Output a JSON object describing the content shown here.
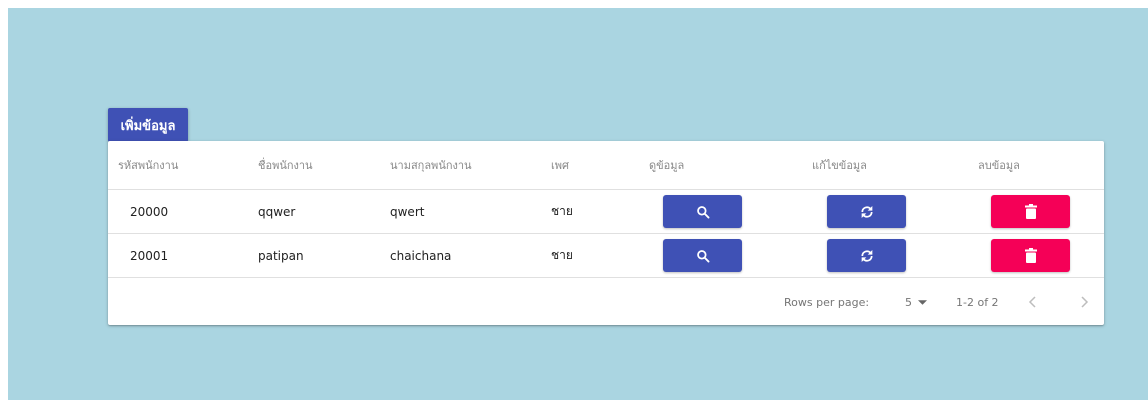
{
  "toolbar": {
    "add_label": "เพิ่มข้อมูล"
  },
  "table": {
    "headers": [
      "รหัสพนักงาน",
      "ชื่อพนักงาน",
      "นามสกุลพนักงาน",
      "เพศ",
      "ดูข้อมูล",
      "แก้ไขข้อมูล",
      "ลบข้อมูล"
    ],
    "rows": [
      {
        "id": "20000",
        "first_name": "qqwer",
        "last_name": "qwert",
        "gender": "ชาย"
      },
      {
        "id": "20001",
        "first_name": "patipan",
        "last_name": "chaichana",
        "gender": "ชาย"
      }
    ]
  },
  "pagination": {
    "rows_per_page_label": "Rows per page:",
    "rows_per_page_value": "5",
    "range_text": "1-2 of 2"
  },
  "icons": {
    "view": "search-icon",
    "edit": "refresh-icon",
    "delete": "trash-icon",
    "prev": "chevron-left-icon",
    "next": "chevron-right-icon",
    "dropdown": "caret-down-icon"
  },
  "colors": {
    "background": "#aad5e1",
    "primary": "#3f51b5",
    "danger": "#f50057"
  }
}
